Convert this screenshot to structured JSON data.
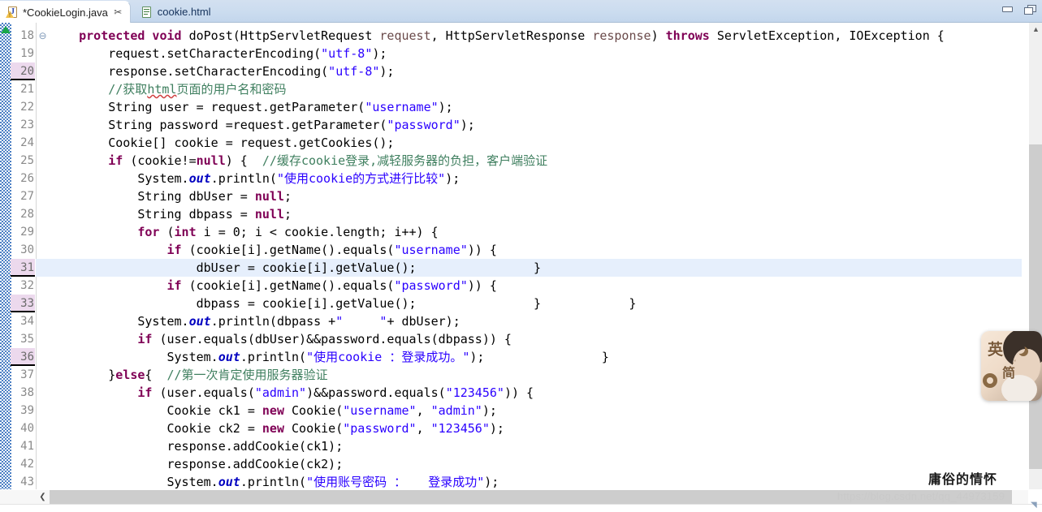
{
  "window": {
    "minimize_label": "Minimize",
    "restore_label": "Restore"
  },
  "tabs": [
    {
      "label": "*CookieLogin.java",
      "icon": "java-file-warning-icon",
      "close": "✂",
      "active": true
    },
    {
      "label": "cookie.html",
      "icon": "html-file-icon",
      "close": "",
      "active": false
    }
  ],
  "editor": {
    "first_line": 18,
    "line_height": 22,
    "changed_lines": [
      20,
      31,
      33,
      36
    ],
    "current_line": 31,
    "fold_lines": [
      18
    ],
    "annotation_marker": "collapse-all-marker",
    "lines": [
      {
        "n": 18,
        "tokens": [
          {
            "t": "    ",
            "c": "plain"
          },
          {
            "t": "protected void ",
            "c": "kw"
          },
          {
            "t": "doPost(HttpServletRequest ",
            "c": "plain"
          },
          {
            "t": "request",
            "c": "param"
          },
          {
            "t": ", HttpServletResponse ",
            "c": "plain"
          },
          {
            "t": "response",
            "c": "param"
          },
          {
            "t": ") ",
            "c": "plain"
          },
          {
            "t": "throws",
            "c": "kw"
          },
          {
            "t": " ServletException, IOException {",
            "c": "plain"
          }
        ]
      },
      {
        "n": 19,
        "tokens": [
          {
            "t": "        request.setCharacterEncoding(",
            "c": "plain"
          },
          {
            "t": "\"utf-8\"",
            "c": "str"
          },
          {
            "t": ");",
            "c": "plain"
          }
        ]
      },
      {
        "n": 20,
        "tokens": [
          {
            "t": "        response.setCharacterEncoding(",
            "c": "plain"
          },
          {
            "t": "\"utf-8\"",
            "c": "str"
          },
          {
            "t": ");",
            "c": "plain"
          }
        ]
      },
      {
        "n": 21,
        "tokens": [
          {
            "t": "        ",
            "c": "plain"
          },
          {
            "t": "//获取",
            "c": "cmt"
          },
          {
            "t": "html",
            "c": "cmt spell"
          },
          {
            "t": "页面的用户名和密码",
            "c": "cmt"
          }
        ]
      },
      {
        "n": 22,
        "tokens": [
          {
            "t": "        String user = request.getParameter(",
            "c": "plain"
          },
          {
            "t": "\"username\"",
            "c": "str"
          },
          {
            "t": ");",
            "c": "plain"
          }
        ]
      },
      {
        "n": 23,
        "tokens": [
          {
            "t": "        String password =request.getParameter(",
            "c": "plain"
          },
          {
            "t": "\"password\"",
            "c": "str"
          },
          {
            "t": ");",
            "c": "plain"
          }
        ]
      },
      {
        "n": 24,
        "tokens": [
          {
            "t": "        Cookie[] cookie = request.getCookies();",
            "c": "plain"
          }
        ]
      },
      {
        "n": 25,
        "tokens": [
          {
            "t": "        ",
            "c": "plain"
          },
          {
            "t": "if",
            "c": "kw"
          },
          {
            "t": " (cookie!=",
            "c": "plain"
          },
          {
            "t": "null",
            "c": "kw"
          },
          {
            "t": ") {  ",
            "c": "plain"
          },
          {
            "t": "//缓存cookie登录,减轻服务器的负担，客户端验证",
            "c": "cmt"
          }
        ]
      },
      {
        "n": 26,
        "tokens": [
          {
            "t": "            System.",
            "c": "plain"
          },
          {
            "t": "out",
            "c": "stat"
          },
          {
            "t": ".println(",
            "c": "plain"
          },
          {
            "t": "\"使用cookie的方式进行比较\"",
            "c": "str"
          },
          {
            "t": ");",
            "c": "plain"
          }
        ]
      },
      {
        "n": 27,
        "tokens": [
          {
            "t": "            String dbUser = ",
            "c": "plain"
          },
          {
            "t": "null",
            "c": "kw"
          },
          {
            "t": ";",
            "c": "plain"
          }
        ]
      },
      {
        "n": 28,
        "tokens": [
          {
            "t": "            String dbpass = ",
            "c": "plain"
          },
          {
            "t": "null",
            "c": "kw"
          },
          {
            "t": ";",
            "c": "plain"
          }
        ]
      },
      {
        "n": 29,
        "tokens": [
          {
            "t": "            ",
            "c": "plain"
          },
          {
            "t": "for",
            "c": "kw"
          },
          {
            "t": " (",
            "c": "plain"
          },
          {
            "t": "int",
            "c": "kw"
          },
          {
            "t": " i = 0; i < cookie.length; i++) {",
            "c": "plain"
          }
        ]
      },
      {
        "n": 30,
        "tokens": [
          {
            "t": "                ",
            "c": "plain"
          },
          {
            "t": "if",
            "c": "kw"
          },
          {
            "t": " (cookie[i].getName().equals(",
            "c": "plain"
          },
          {
            "t": "\"username\"",
            "c": "str"
          },
          {
            "t": ")) {",
            "c": "plain"
          }
        ]
      },
      {
        "n": 31,
        "tokens": [
          {
            "t": "                    dbUser = cookie[i].getValue();                }",
            "c": "plain"
          }
        ]
      },
      {
        "n": 32,
        "tokens": [
          {
            "t": "                ",
            "c": "plain"
          },
          {
            "t": "if",
            "c": "kw"
          },
          {
            "t": " (cookie[i].getName().equals(",
            "c": "plain"
          },
          {
            "t": "\"password\"",
            "c": "str"
          },
          {
            "t": ")) {",
            "c": "plain"
          }
        ]
      },
      {
        "n": 33,
        "tokens": [
          {
            "t": "                    dbpass = cookie[i].getValue();                }            }",
            "c": "plain"
          }
        ]
      },
      {
        "n": 34,
        "tokens": [
          {
            "t": "            System.",
            "c": "plain"
          },
          {
            "t": "out",
            "c": "stat"
          },
          {
            "t": ".println(dbpass +",
            "c": "plain"
          },
          {
            "t": "\"     \"",
            "c": "str"
          },
          {
            "t": "+ dbUser);",
            "c": "plain"
          }
        ]
      },
      {
        "n": 35,
        "tokens": [
          {
            "t": "            ",
            "c": "plain"
          },
          {
            "t": "if",
            "c": "kw"
          },
          {
            "t": " (user.equals(dbUser)&&password.equals(dbpass)) {",
            "c": "plain"
          }
        ]
      },
      {
        "n": 36,
        "tokens": [
          {
            "t": "                System.",
            "c": "plain"
          },
          {
            "t": "out",
            "c": "stat"
          },
          {
            "t": ".println(",
            "c": "plain"
          },
          {
            "t": "\"使用cookie ：登录成功。\"",
            "c": "str"
          },
          {
            "t": ");                }",
            "c": "plain"
          }
        ]
      },
      {
        "n": 37,
        "tokens": [
          {
            "t": "        }",
            "c": "plain"
          },
          {
            "t": "else",
            "c": "kw"
          },
          {
            "t": "{  ",
            "c": "plain"
          },
          {
            "t": "//第一次肯定使用服务器验证",
            "c": "cmt"
          }
        ]
      },
      {
        "n": 38,
        "tokens": [
          {
            "t": "            ",
            "c": "plain"
          },
          {
            "t": "if",
            "c": "kw"
          },
          {
            "t": " (user.equals(",
            "c": "plain"
          },
          {
            "t": "\"admin\"",
            "c": "str"
          },
          {
            "t": ")&&password.equals(",
            "c": "plain"
          },
          {
            "t": "\"123456\"",
            "c": "str"
          },
          {
            "t": ")) {",
            "c": "plain"
          }
        ]
      },
      {
        "n": 39,
        "tokens": [
          {
            "t": "                Cookie ck1 = ",
            "c": "plain"
          },
          {
            "t": "new",
            "c": "kw"
          },
          {
            "t": " Cookie(",
            "c": "plain"
          },
          {
            "t": "\"username\"",
            "c": "str"
          },
          {
            "t": ", ",
            "c": "plain"
          },
          {
            "t": "\"admin\"",
            "c": "str"
          },
          {
            "t": ");",
            "c": "plain"
          }
        ]
      },
      {
        "n": 40,
        "tokens": [
          {
            "t": "                Cookie ck2 = ",
            "c": "plain"
          },
          {
            "t": "new",
            "c": "kw"
          },
          {
            "t": " Cookie(",
            "c": "plain"
          },
          {
            "t": "\"password\"",
            "c": "str"
          },
          {
            "t": ", ",
            "c": "plain"
          },
          {
            "t": "\"123456\"",
            "c": "str"
          },
          {
            "t": ");",
            "c": "plain"
          }
        ]
      },
      {
        "n": 41,
        "tokens": [
          {
            "t": "                response.addCookie(ck1);",
            "c": "plain"
          }
        ]
      },
      {
        "n": 42,
        "tokens": [
          {
            "t": "                response.addCookie(ck2);",
            "c": "plain"
          }
        ]
      },
      {
        "n": 43,
        "tokens": [
          {
            "t": "                System.",
            "c": "plain"
          },
          {
            "t": "out",
            "c": "stat"
          },
          {
            "t": ".println(",
            "c": "plain"
          },
          {
            "t": "\"使用账号密码 ：   登录成功\"",
            "c": "str"
          },
          {
            "t": ");",
            "c": "plain"
          }
        ]
      }
    ]
  },
  "scrollbars": {
    "vertical_up_arrow": "▲",
    "horizontal_left_arrow": "❮"
  },
  "ime_panel": {
    "mode_language": "英",
    "mode_script": "简",
    "sparkle": "·'"
  },
  "watermarks": {
    "author": "庸俗的情怀",
    "url": "https://blog.csdn.net/qq_44973159"
  },
  "colors": {
    "keyword": "#7f0055",
    "string": "#2a00ff",
    "comment": "#3f7f5f",
    "static_field": "#0000c0",
    "current_line_bg": "#e6effc",
    "changed_line_bg": "#ecd9ed",
    "tabbar_bg": "#c9dbee"
  }
}
